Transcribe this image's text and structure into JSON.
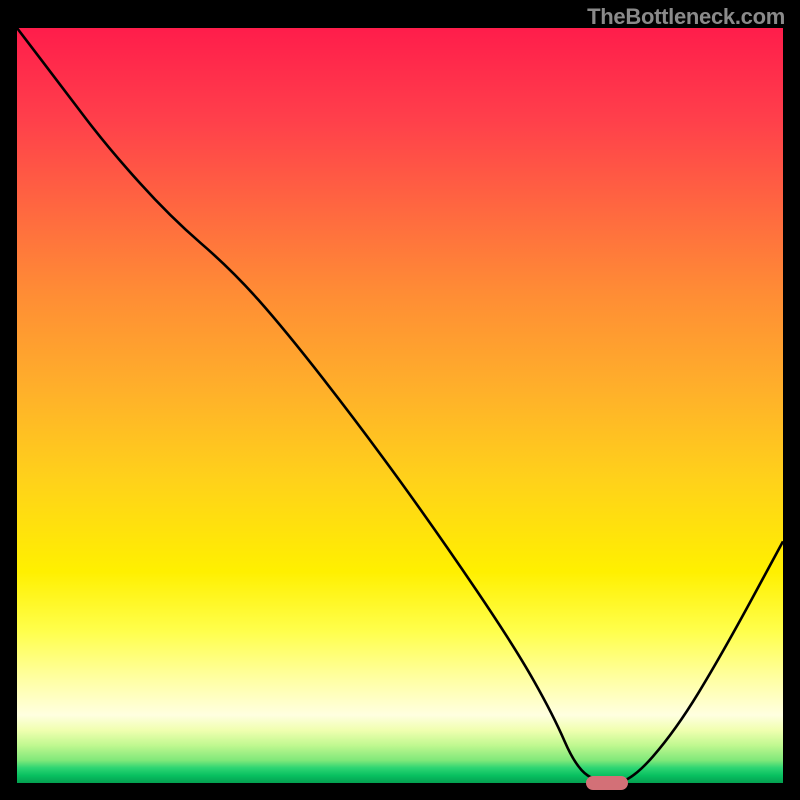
{
  "watermark": "TheBottleneck.com",
  "colors": {
    "background": "#000000",
    "curve": "#000000",
    "marker": "#d37077",
    "gradient_top": "#ff1d4b",
    "gradient_bottom": "#04a050"
  },
  "chart_data": {
    "type": "line",
    "title": "",
    "xlabel": "",
    "ylabel": "",
    "xlim": [
      0,
      100
    ],
    "ylim": [
      0,
      100
    ],
    "series": [
      {
        "name": "bottleneck-curve",
        "x": [
          0,
          6,
          12,
          20,
          28,
          35,
          45,
          55,
          65,
          70,
          73,
          76,
          80,
          86,
          92,
          100
        ],
        "y": [
          100,
          92,
          84,
          75,
          68,
          60,
          47,
          33,
          18,
          9,
          2,
          0,
          0,
          7,
          17,
          32
        ]
      }
    ],
    "annotations": [
      {
        "name": "optimal-marker",
        "x": 77,
        "y": 0
      }
    ]
  }
}
